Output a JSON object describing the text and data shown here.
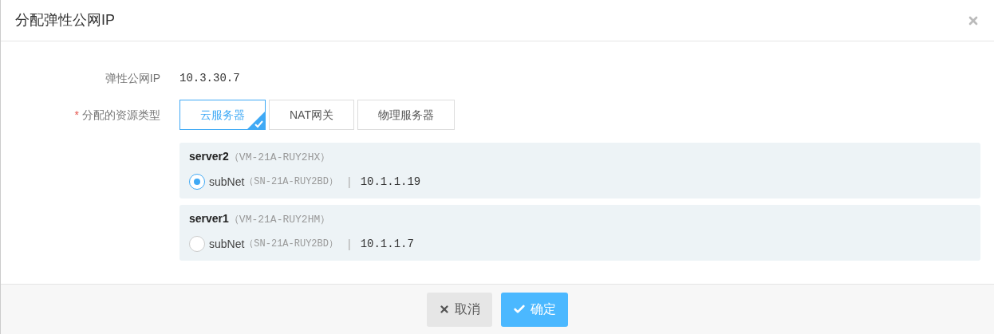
{
  "dialog": {
    "title": "分配弹性公网IP"
  },
  "fields": [
    {
      "label": "弹性公网IP",
      "value": "10.3.30.7"
    },
    {
      "label": "分配的资源类型",
      "required_mark": "*"
    }
  ],
  "resource_types": [
    {
      "label": "云服务器",
      "selected": true
    },
    {
      "label": "NAT网关",
      "selected": false
    },
    {
      "label": "物理服务器",
      "selected": false
    }
  ],
  "servers": [
    {
      "name": "server2",
      "id": "（VM-21A-RUY2HX）",
      "subnet": "subNet",
      "subnet_id": "（SN-21A-RUY2BD）",
      "separator": "|",
      "ip": "10.1.1.19",
      "selected": true
    },
    {
      "name": "server1",
      "id": "（VM-21A-RUY2HM）",
      "subnet": "subNet",
      "subnet_id": "（SN-21A-RUY2BD）",
      "separator": "|",
      "ip": "10.1.1.7",
      "selected": false
    }
  ],
  "buttons": [
    {
      "kind": "cancel",
      "label": "取消"
    },
    {
      "kind": "confirm",
      "label": "确定"
    }
  ]
}
